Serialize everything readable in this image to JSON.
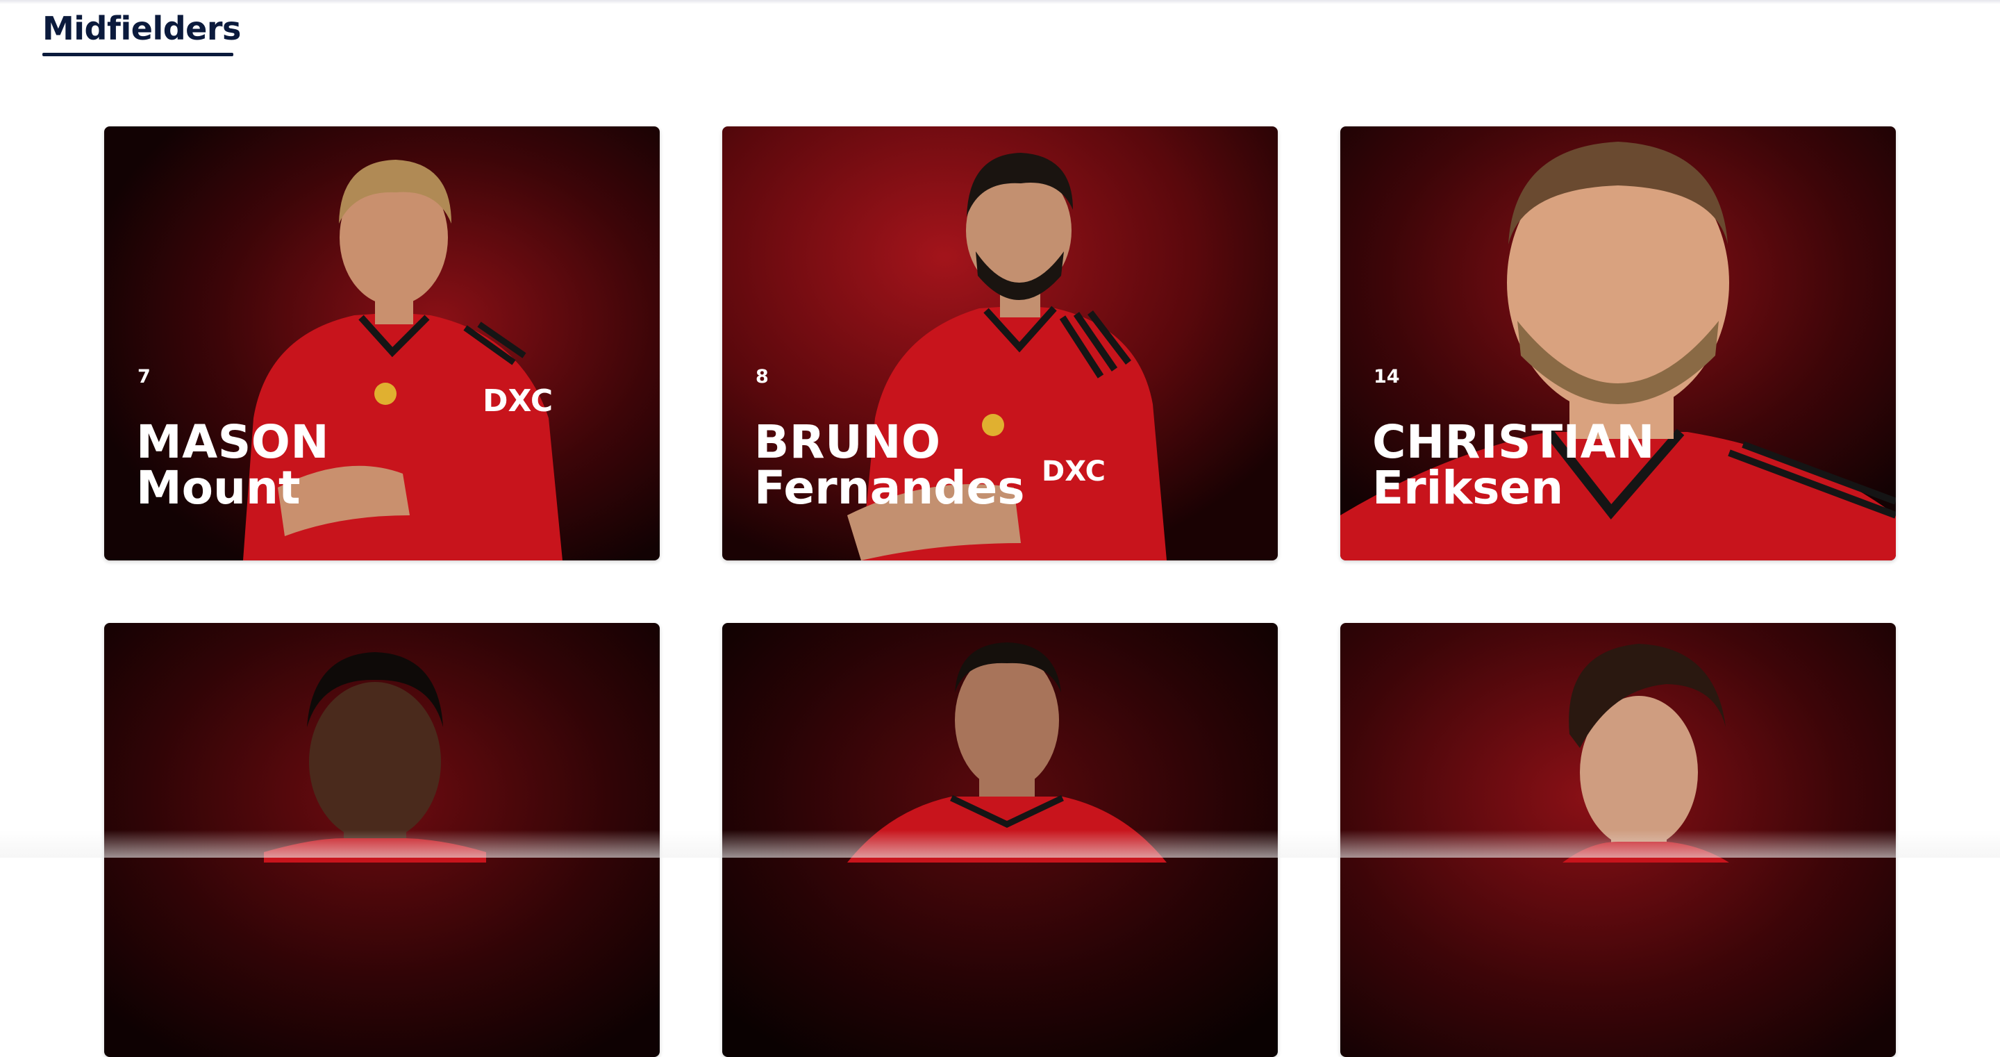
{
  "section": {
    "title": "Midfielders"
  },
  "colors": {
    "heading": "#0b1a3c",
    "card_dark": "#1a0304",
    "card_red": "#7a0d12",
    "kit_red": "#c8141c",
    "kit_black": "#151515",
    "skin": "#c9906e"
  },
  "players": [
    {
      "number": "7",
      "first_name": "MASON",
      "last_name": "Mount",
      "portrait_icon": "player-portrait"
    },
    {
      "number": "8",
      "first_name": "BRUNO",
      "last_name": "Fernandes",
      "portrait_icon": "player-portrait"
    },
    {
      "number": "14",
      "first_name": "CHRISTIAN",
      "last_name": "Eriksen",
      "portrait_icon": "player-portrait"
    },
    {
      "number": "",
      "first_name": "",
      "last_name": "",
      "portrait_icon": "player-portrait"
    },
    {
      "number": "",
      "first_name": "",
      "last_name": "",
      "portrait_icon": "player-portrait"
    },
    {
      "number": "",
      "first_name": "",
      "last_name": "",
      "portrait_icon": "player-portrait"
    }
  ]
}
